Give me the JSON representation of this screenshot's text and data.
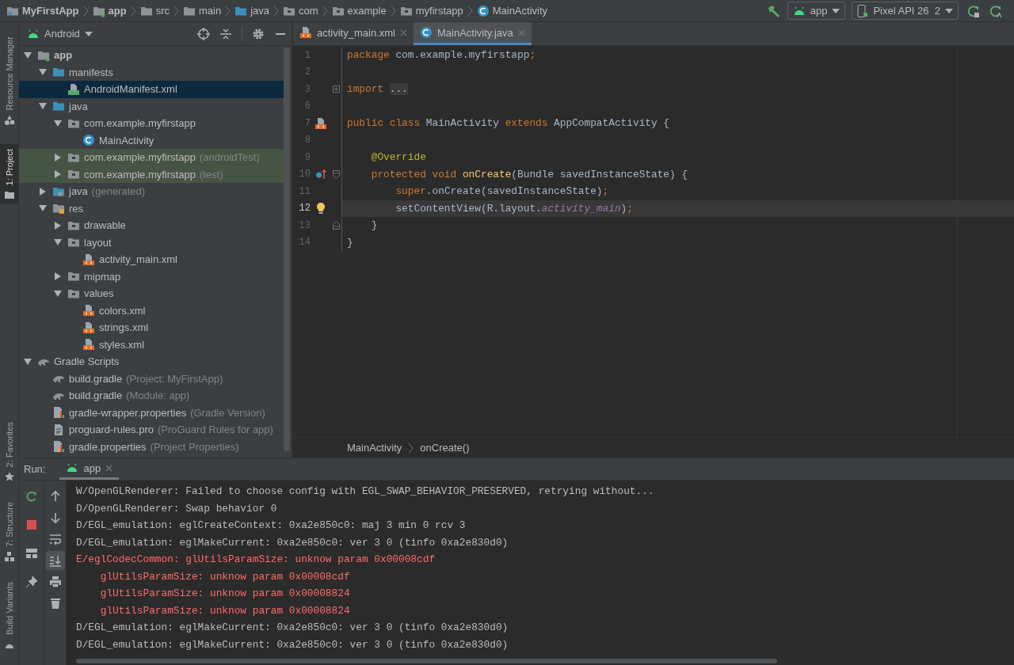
{
  "breadcrumbs": [
    {
      "label": "MyFirstApp",
      "kind": "project",
      "bold": true
    },
    {
      "label": "app",
      "kind": "module",
      "bold": true
    },
    {
      "label": "src",
      "kind": "folder",
      "bold": false
    },
    {
      "label": "main",
      "kind": "folder",
      "bold": false
    },
    {
      "label": "java",
      "kind": "source",
      "bold": false
    },
    {
      "label": "com",
      "kind": "package",
      "bold": false
    },
    {
      "label": "example",
      "kind": "package",
      "bold": false
    },
    {
      "label": "myfirstapp",
      "kind": "package",
      "bold": false
    },
    {
      "label": "MainActivity",
      "kind": "class",
      "bold": false
    }
  ],
  "run_config": {
    "module": "app",
    "device": "Pixel API 26  2"
  },
  "tool_strip": {
    "top": [
      {
        "label": "Resource Manager",
        "kind": "resources",
        "selected": false
      },
      {
        "label": "1: Project",
        "kind": "project",
        "selected": true
      }
    ],
    "bottom": [
      {
        "label": "2: Favorites",
        "kind": "favorites",
        "selected": false
      },
      {
        "label": "7: Structure",
        "kind": "structure",
        "selected": false
      },
      {
        "label": "Build Variants",
        "kind": "variants",
        "selected": false
      }
    ]
  },
  "project": {
    "view": "Android",
    "tree": [
      {
        "label": "app",
        "kind": "module",
        "bold": true,
        "expanded": true,
        "selected": false,
        "children": [
          {
            "label": "manifests",
            "kind": "source",
            "expanded": true,
            "selected": false,
            "children": [
              {
                "label": "AndroidManifest.xml",
                "kind": "manifest",
                "selected": true
              }
            ]
          },
          {
            "label": "java",
            "kind": "source",
            "expanded": true,
            "selected": false,
            "children": [
              {
                "label": "com.example.myfirstapp",
                "kind": "package",
                "expanded": true,
                "selected": false,
                "children": [
                  {
                    "label": "MainActivity",
                    "kind": "class",
                    "selected": false
                  }
                ]
              },
              {
                "label": "com.example.myfirstapp",
                "note": "(androidTest)",
                "kind": "package",
                "expanded": false,
                "test": true,
                "selected": false
              },
              {
                "label": "com.example.myfirstapp",
                "note": "(test)",
                "kind": "package",
                "expanded": false,
                "test": true,
                "selected": false
              }
            ]
          },
          {
            "label": "java",
            "note": "(generated)",
            "kind": "generated",
            "expanded": false,
            "selected": false
          },
          {
            "label": "res",
            "kind": "res",
            "expanded": true,
            "selected": false,
            "children": [
              {
                "label": "drawable",
                "kind": "package",
                "expanded": false,
                "selected": false
              },
              {
                "label": "layout",
                "kind": "package",
                "expanded": true,
                "selected": false,
                "children": [
                  {
                    "label": "activity_main.xml",
                    "kind": "xml",
                    "selected": false
                  }
                ]
              },
              {
                "label": "mipmap",
                "kind": "package",
                "expanded": false,
                "selected": false
              },
              {
                "label": "values",
                "kind": "package",
                "expanded": true,
                "selected": false,
                "children": [
                  {
                    "label": "colors.xml",
                    "kind": "xml",
                    "selected": false
                  },
                  {
                    "label": "strings.xml",
                    "kind": "xml",
                    "selected": false
                  },
                  {
                    "label": "styles.xml",
                    "kind": "xml",
                    "selected": false
                  }
                ]
              }
            ]
          }
        ]
      },
      {
        "label": "Gradle Scripts",
        "kind": "gradle",
        "expanded": true,
        "selected": false,
        "children": [
          {
            "label": "build.gradle",
            "note": "(Project: MyFirstApp)",
            "kind": "gradle",
            "selected": false
          },
          {
            "label": "build.gradle",
            "note": "(Module: app)",
            "kind": "gradle",
            "selected": false
          },
          {
            "label": "gradle-wrapper.properties",
            "note": "(Gradle Version)",
            "kind": "properties",
            "selected": false
          },
          {
            "label": "proguard-rules.pro",
            "note": "(ProGuard Rules for app)",
            "kind": "text",
            "selected": false
          },
          {
            "label": "gradle.properties",
            "note": "(Project Properties)",
            "kind": "properties",
            "selected": false
          }
        ]
      }
    ]
  },
  "editor": {
    "tabs": [
      {
        "label": "activity_main.xml",
        "kind": "xml",
        "selected": false
      },
      {
        "label": "MainActivity.java",
        "kind": "class",
        "selected": true
      }
    ],
    "lines": [
      {
        "number": "1",
        "current": false,
        "tokens": [
          {
            "text": "package",
            "kind": "kw"
          },
          {
            "text": " com.example.myfirstapp",
            "kind": "plain"
          },
          {
            "text": ";",
            "kind": "kw"
          }
        ]
      },
      {
        "number": "2",
        "current": false
      },
      {
        "number": "3",
        "current": false,
        "fold": {
          "kind": "collapsed"
        },
        "tokens": [
          {
            "text": "import ",
            "kind": "kw"
          },
          {
            "text": "...",
            "kind": "folded"
          }
        ]
      },
      {
        "number": "6",
        "current": false
      },
      {
        "number": "7",
        "current": false,
        "gutter": {
          "kind": "layout"
        },
        "tokens": [
          {
            "text": "public class",
            "kind": "kw"
          },
          {
            "text": " MainActivity ",
            "kind": "plain"
          },
          {
            "text": "extends",
            "kind": "kw"
          },
          {
            "text": " AppCompatActivity {",
            "kind": "plain"
          }
        ]
      },
      {
        "number": "8",
        "current": false
      },
      {
        "number": "9",
        "current": false,
        "tokens": [
          {
            "text": "    @Override",
            "kind": "annotation"
          }
        ]
      },
      {
        "number": "10",
        "current": false,
        "gutter": {
          "kind": "override"
        },
        "fold": {
          "kind": "open"
        },
        "tokens": [
          {
            "text": "    protected void ",
            "kind": "kw"
          },
          {
            "text": "onCreate",
            "kind": "method"
          },
          {
            "text": "(Bundle savedInstanceState) {",
            "kind": "plain"
          }
        ]
      },
      {
        "number": "11",
        "current": false,
        "tokens": [
          {
            "text": "        super",
            "kind": "kw"
          },
          {
            "text": ".onCreate(savedInstanceState)",
            "kind": "plain"
          },
          {
            "text": ";",
            "kind": "kw"
          }
        ]
      },
      {
        "number": "12",
        "current": true,
        "gutter": {
          "kind": "bulb"
        },
        "tokens": [
          {
            "text": "        setContentView(R.layout.",
            "kind": "plain"
          },
          {
            "text": "activity_main",
            "kind": "field"
          },
          {
            "text": ")",
            "kind": "plain"
          },
          {
            "text": ";",
            "kind": "kw"
          }
        ]
      },
      {
        "number": "13",
        "current": false,
        "fold": {
          "kind": "end"
        },
        "tokens": [
          {
            "text": "    }",
            "kind": "plain"
          }
        ]
      },
      {
        "number": "14",
        "current": false,
        "tokens": [
          {
            "text": "}",
            "kind": "plain"
          }
        ]
      }
    ],
    "breadcrumb": [
      "MainActivity",
      "onCreate()"
    ]
  },
  "run": {
    "label": "Run:",
    "tab": "app",
    "scroll_to_end": true,
    "soft_wrap": false,
    "log": [
      {
        "kind": "info",
        "text": "W/OpenGLRenderer: Failed to choose config with EGL_SWAP_BEHAVIOR_PRESERVED, retrying without..."
      },
      {
        "kind": "info",
        "text": "D/OpenGLRenderer: Swap behavior 0"
      },
      {
        "kind": "info",
        "text": "D/EGL_emulation: eglCreateContext: 0xa2e850c0: maj 3 min 0 rcv 3"
      },
      {
        "kind": "info",
        "text": "D/EGL_emulation: eglMakeCurrent: 0xa2e850c0: ver 3 0 (tinfo 0xa2e830d0)"
      },
      {
        "kind": "error",
        "text": "E/eglCodecCommon: glUtilsParamSize: unknow param 0x00008cdf"
      },
      {
        "kind": "error",
        "text": "    glUtilsParamSize: unknow param 0x00008cdf"
      },
      {
        "kind": "error",
        "text": "    glUtilsParamSize: unknow param 0x00008824"
      },
      {
        "kind": "error",
        "text": "    glUtilsParamSize: unknow param 0x00008824"
      },
      {
        "kind": "info",
        "text": "D/EGL_emulation: eglMakeCurrent: 0xa2e850c0: ver 3 0 (tinfo 0xa2e830d0)"
      },
      {
        "kind": "info",
        "text": "D/EGL_emulation: eglMakeCurrent: 0xa2e850c0: ver 3 0 (tinfo 0xa2e830d0)"
      }
    ]
  }
}
